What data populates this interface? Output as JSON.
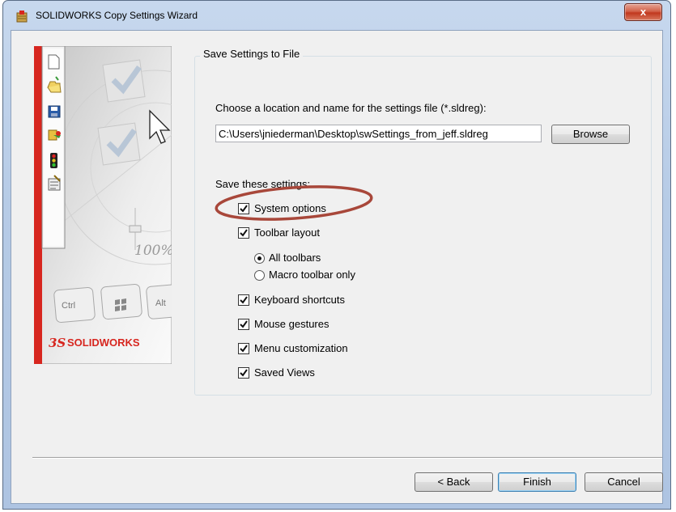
{
  "window": {
    "title": "SOLIDWORKS Copy Settings Wizard",
    "close_glyph": "x"
  },
  "art": {
    "zoom_text": "100%",
    "keys": [
      "Ctrl",
      "Alt"
    ],
    "brand": "SOLIDWORKS",
    "toolbar_icons": [
      "new-document-icon",
      "open-folder-icon",
      "save-disk-icon",
      "rebuild-icon",
      "traffic-light-icon",
      "options-icon"
    ]
  },
  "group": {
    "legend": "Save Settings to File",
    "choose_label": "Choose a location and name for the settings file (*.sldreg):",
    "path_value": "C:\\Users\\jniederman\\Desktop\\swSettings_from_jeff.sldreg",
    "browse_label": "Browse",
    "save_these_label": "Save these settings:",
    "options": [
      {
        "label": "System options",
        "checked": true
      },
      {
        "label": "Toolbar layout",
        "checked": true
      },
      {
        "label": "Keyboard shortcuts",
        "checked": true
      },
      {
        "label": "Mouse gestures",
        "checked": true
      },
      {
        "label": "Menu customization",
        "checked": true
      },
      {
        "label": "Saved Views",
        "checked": true
      }
    ],
    "toolbar_radios": [
      {
        "label": "All toolbars",
        "selected": true
      },
      {
        "label": "Macro toolbar only",
        "selected": false
      }
    ]
  },
  "footer": {
    "back_label": "< Back",
    "finish_label": "Finish",
    "cancel_label": "Cancel"
  },
  "colors": {
    "highlight_oval": "#a8473a",
    "brand_red": "#d7261f"
  }
}
